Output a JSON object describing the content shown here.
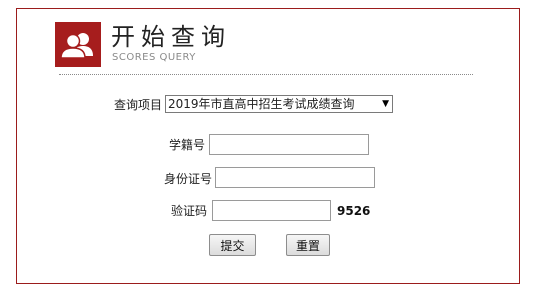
{
  "header": {
    "title": "开始查询",
    "subtitle": "SCORES QUERY",
    "logo_icon": "users-icon",
    "brand_color": "#a61d1d"
  },
  "form": {
    "query_item": {
      "label": "查询项目",
      "selected": "2019年市直高中招生考试成绩查询"
    },
    "student_id": {
      "label": "学籍号",
      "value": ""
    },
    "id_card": {
      "label": "身份证号",
      "value": ""
    },
    "captcha": {
      "label": "验证码",
      "value": "",
      "code": "9526"
    },
    "submit_label": "提交",
    "reset_label": "重置"
  }
}
